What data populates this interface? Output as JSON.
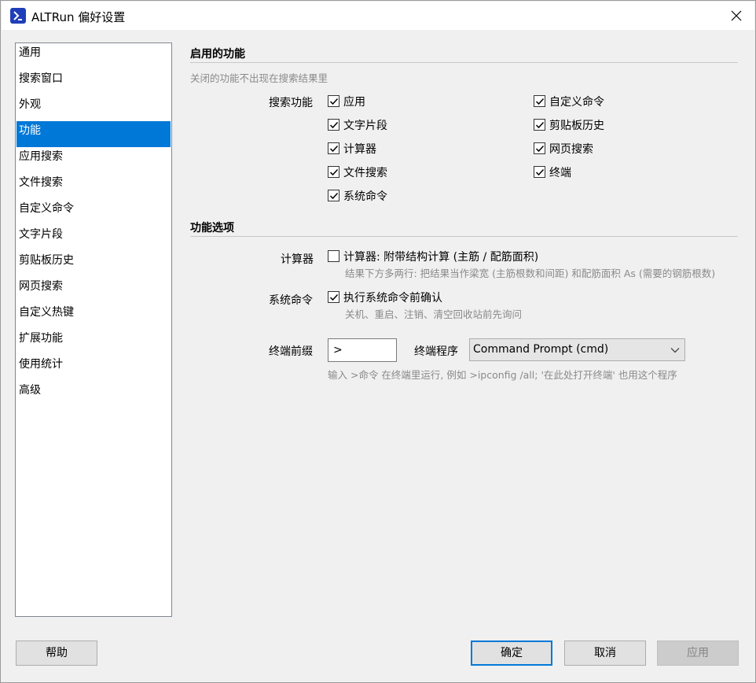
{
  "window": {
    "title": "ALTRun 偏好设置"
  },
  "nav": {
    "items": [
      {
        "label": "通用",
        "selected": false
      },
      {
        "label": "搜索窗口",
        "selected": false
      },
      {
        "label": "外观",
        "selected": false
      },
      {
        "label": "功能",
        "selected": true
      },
      {
        "label": "应用搜索",
        "selected": false
      },
      {
        "label": "文件搜索",
        "selected": false
      },
      {
        "label": "自定义命令",
        "selected": false
      },
      {
        "label": "文字片段",
        "selected": false
      },
      {
        "label": "剪贴板历史",
        "selected": false
      },
      {
        "label": "网页搜索",
        "selected": false
      },
      {
        "label": "自定义热键",
        "selected": false
      },
      {
        "label": "扩展功能",
        "selected": false
      },
      {
        "label": "使用统计",
        "selected": false
      },
      {
        "label": "高级",
        "selected": false
      }
    ]
  },
  "enabled_section": {
    "title": "启用的功能",
    "hint": "关闭的功能不出现在搜索结果里",
    "search_label": "搜索功能",
    "features": [
      {
        "label": "应用",
        "checked": true
      },
      {
        "label": "文字片段",
        "checked": true
      },
      {
        "label": "计算器",
        "checked": true
      },
      {
        "label": "文件搜索",
        "checked": true
      },
      {
        "label": "系统命令",
        "checked": true
      },
      {
        "label": "自定义命令",
        "checked": true
      },
      {
        "label": "剪贴板历史",
        "checked": true
      },
      {
        "label": "网页搜索",
        "checked": true
      },
      {
        "label": "终端",
        "checked": true
      }
    ]
  },
  "options_section": {
    "title": "功能选项",
    "calculator": {
      "label": "计算器",
      "checkbox_label": "计算器: 附带结构计算 (主筋 / 配筋面积)",
      "checked": false,
      "hint": "结果下方多两行: 把结果当作梁宽 (主筋根数和间距) 和配筋面积 As (需要的钢筋根数)"
    },
    "system_command": {
      "label": "系统命令",
      "checkbox_label": "执行系统命令前确认",
      "checked": true,
      "hint": "关机、重启、注销、清空回收站前先询问"
    },
    "terminal": {
      "prefix_label": "终端前缀",
      "prefix_value": ">",
      "program_label": "终端程序",
      "program_value": "Command Prompt (cmd)",
      "hint": "输入 >命令 在终端里运行, 例如 >ipconfig /all; '在此处打开终端' 也用这个程序"
    }
  },
  "buttons": {
    "help": "帮助",
    "ok": "确定",
    "cancel": "取消",
    "apply": "应用"
  },
  "colors": {
    "accent": "#0078d7",
    "app_icon": "#1f3fb8",
    "hint_text": "#8a8a8a"
  }
}
